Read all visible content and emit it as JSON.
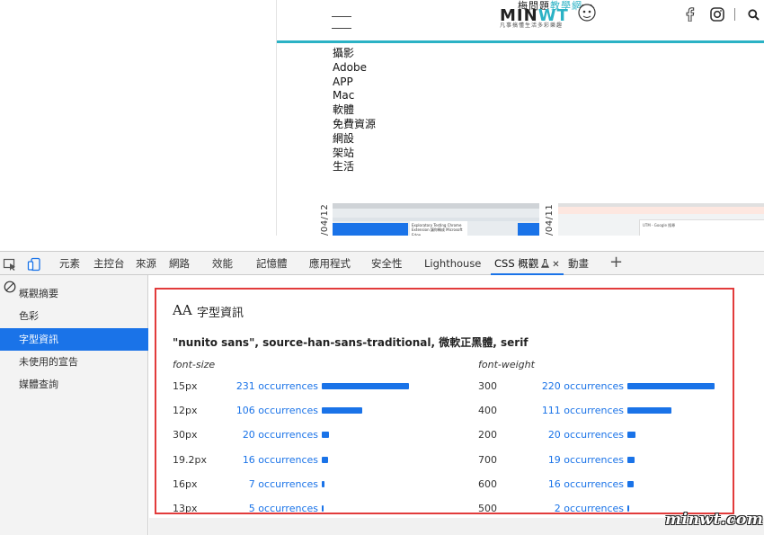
{
  "site": {
    "logo_top": "梅問題",
    "logo_top_accent": "教學網",
    "logo_main": "MIN",
    "logo_main_accent": "WT",
    "logo_sub": "凡事搞懂生活多彩樂趣",
    "menu": [
      "攝影",
      "Adobe",
      "APP",
      "Mac",
      "軟體",
      "免費資源",
      "網設",
      "架站",
      "生活"
    ],
    "thumb_dates": [
      "/04/12",
      "/04/11"
    ],
    "thumb1_card_text": "Exploratory Testing Chrome Extension 讓你轉成 Microsoft Edge",
    "thumb2_panel_text": "UTM - Google 搜尋",
    "accent_color": "#2bb2c5"
  },
  "devtools": {
    "tabs": [
      "元素",
      "主控台",
      "來源",
      "網路",
      "效能",
      "記憶體",
      "應用程式",
      "安全性",
      "Lighthouse",
      "CSS 概觀",
      "動畫"
    ],
    "active_tab_close": "✕",
    "sidebar": [
      "概觀摘要",
      "色彩",
      "字型資訊",
      "未使用的宣告",
      "媒體查詢"
    ],
    "active_sidebar_index": 2,
    "font_panel": {
      "icon_text": "AA",
      "title": "字型資訊",
      "family": "\"nunito sans\", source-han-sans-traditional, 微軟正黑體, serif",
      "size_header": "font-size",
      "weight_header": "font-weight",
      "sizes": [
        {
          "label": "15px",
          "count": "231 occurrences",
          "n": 231
        },
        {
          "label": "12px",
          "count": "106 occurrences",
          "n": 106
        },
        {
          "label": "30px",
          "count": "20 occurrences",
          "n": 20
        },
        {
          "label": "19.2px",
          "count": "16 occurrences",
          "n": 16
        },
        {
          "label": "16px",
          "count": "7 occurrences",
          "n": 7
        },
        {
          "label": "13px",
          "count": "5 occurrences",
          "n": 5
        }
      ],
      "weights": [
        {
          "label": "300",
          "count": "220 occurrences",
          "n": 220
        },
        {
          "label": "400",
          "count": "111 occurrences",
          "n": 111
        },
        {
          "label": "200",
          "count": "20 occurrences",
          "n": 20
        },
        {
          "label": "700",
          "count": "19 occurrences",
          "n": 19
        },
        {
          "label": "600",
          "count": "16 occurrences",
          "n": 16
        },
        {
          "label": "500",
          "count": "2 occurrences",
          "n": 2
        }
      ]
    },
    "accent_color": "#1a73e8",
    "highlight_border_color": "#e23b3b"
  },
  "watermark": "minwt.com"
}
